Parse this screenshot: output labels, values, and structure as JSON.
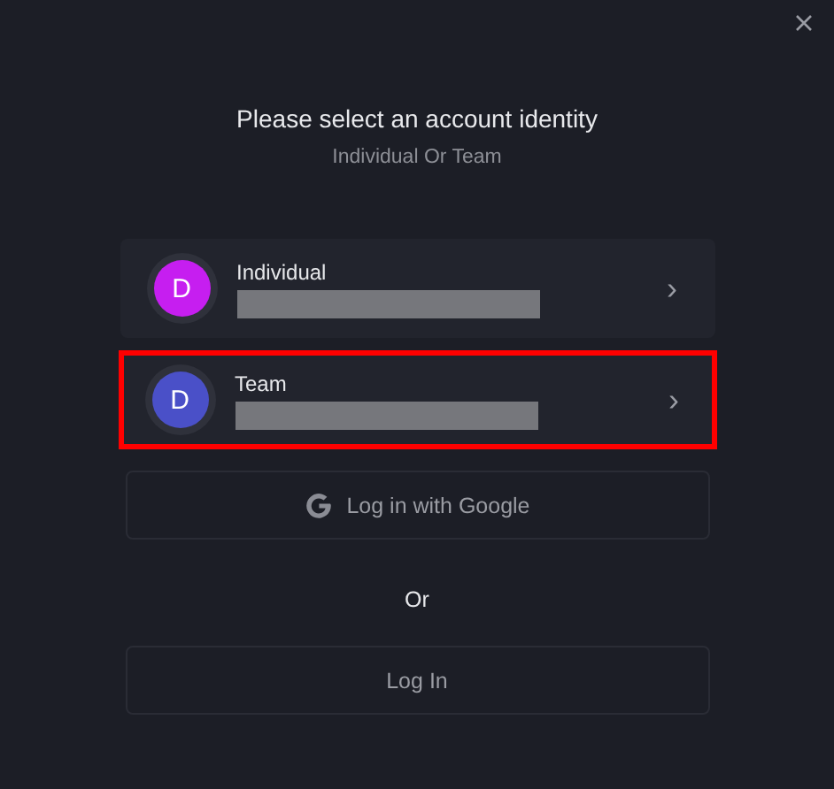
{
  "title": "Please select an account identity",
  "subtitle": "Individual Or Team",
  "accounts": [
    {
      "initial": "D",
      "name": "Individual",
      "color": "#c61ef0",
      "redacted": true,
      "highlighted": false,
      "chevron": "›"
    },
    {
      "initial": "D",
      "name": "Team",
      "color": "#4a50c8",
      "redacted": true,
      "highlighted": true,
      "chevron": "›"
    }
  ],
  "google_button": {
    "label": "Log in with Google"
  },
  "separator": "Or",
  "login_button": {
    "label": "Log In"
  }
}
